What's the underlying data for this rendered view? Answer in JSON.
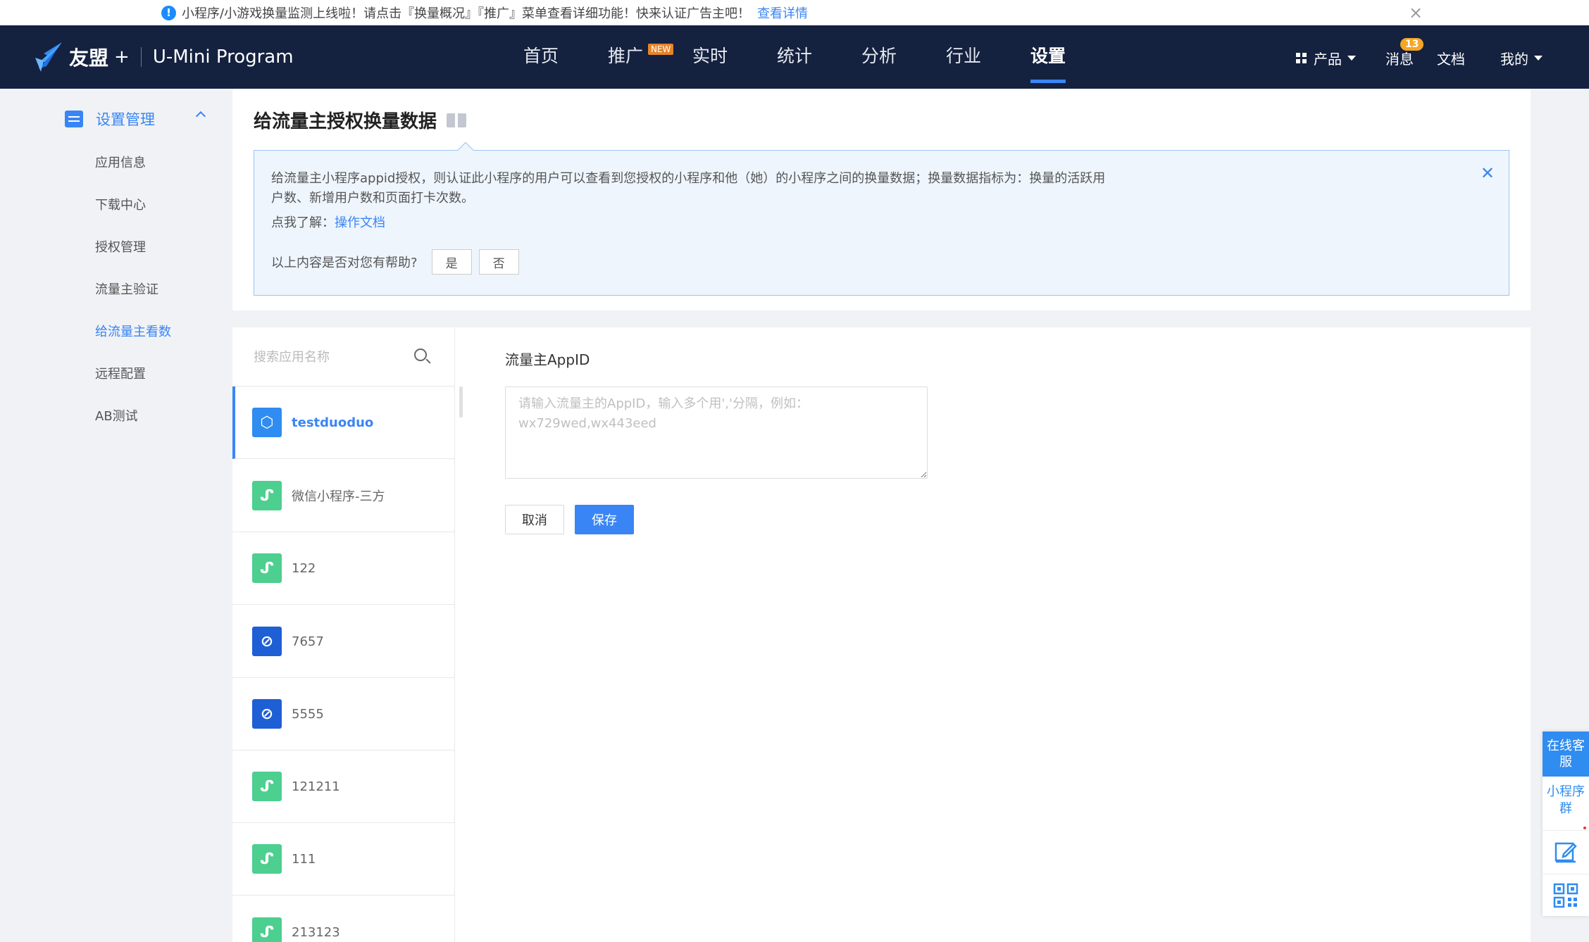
{
  "notice": {
    "text": "小程序/小游戏换量监测上线啦！请点击『换量概况』『推广』菜单查看详细功能！快来认证广告主吧！",
    "link": "查看详情",
    "close": "×"
  },
  "header": {
    "brand": "友盟",
    "plus": "+",
    "product": "U-Mini Program",
    "nav": [
      "首页",
      "推广",
      "实时",
      "统计",
      "分析",
      "行业",
      "设置"
    ],
    "new_tag": "NEW",
    "right": {
      "products": "产品",
      "messages": "消息",
      "messages_badge": "13",
      "docs": "文档",
      "mine": "我的"
    }
  },
  "sidebar": {
    "section": "设置管理",
    "items": [
      "应用信息",
      "下载中心",
      "授权管理",
      "流量主验证",
      "给流量主看数",
      "远程配置",
      "AB测试"
    ]
  },
  "page": {
    "title": "给流量主授权换量数据"
  },
  "help": {
    "text": "给流量主小程序appid授权，则认证此小程序的用户可以查看到您授权的小程序和他（她）的小程序之间的换量数据；换量数据指标为：换量的活跃用户数、新增用户数和页面打卡次数。",
    "learn_prefix": "点我了解：",
    "learn_link": "操作文档",
    "ask": "以上内容是否对您有帮助?",
    "yes": "是",
    "no": "否",
    "close": "✕"
  },
  "app_list": {
    "search_placeholder": "搜索应用名称",
    "apps": [
      {
        "name": "testduoduo",
        "icon": "blue"
      },
      {
        "name": "微信小程序-三方",
        "icon": "green"
      },
      {
        "name": "122",
        "icon": "green"
      },
      {
        "name": "7657",
        "icon": "navy"
      },
      {
        "name": "5555",
        "icon": "navy"
      },
      {
        "name": "121211",
        "icon": "green"
      },
      {
        "name": "111",
        "icon": "green"
      },
      {
        "name": "213123",
        "icon": "green"
      }
    ]
  },
  "form": {
    "label": "流量主AppID",
    "placeholder": "请输入流量主的AppID，输入多个用','分隔，例如：wx729wed,wx443eed",
    "value": "",
    "cancel": "取消",
    "save": "保存"
  },
  "float_panel": {
    "customer_service": "在线客服",
    "group": "小程序群"
  },
  "colors": {
    "accent": "#3a85f5",
    "header_bg": "#14213f",
    "new_tag": "#e5842a",
    "badge": "#f5a623"
  }
}
